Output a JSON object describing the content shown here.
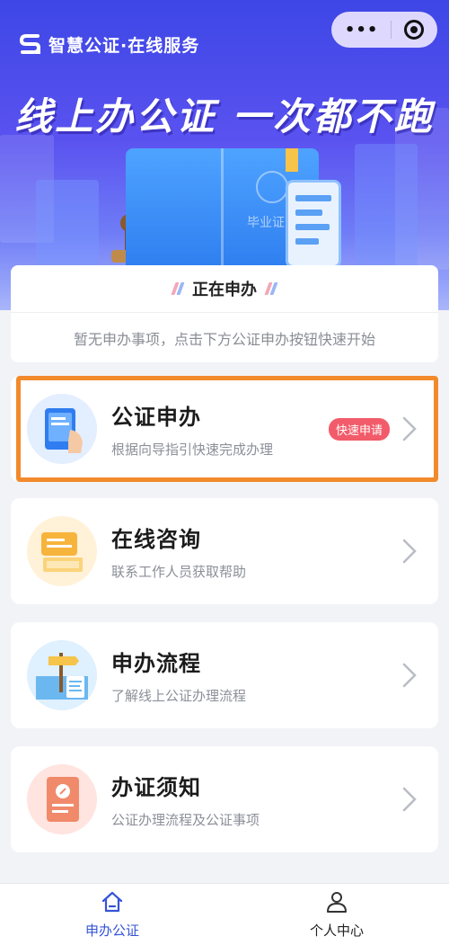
{
  "header": {
    "brand_title": "智慧公证·在线服务",
    "slogan": "线上办公证 一次都不跑",
    "banner_book_label": "毕业证"
  },
  "capsule": {
    "more_icon": "more-dots-icon",
    "close_icon": "target-circle-icon"
  },
  "status": {
    "title": "正在申办",
    "empty_text": "暂无申办事项，点击下方公证申办按钮快速开始"
  },
  "services": [
    {
      "title": "公证申办",
      "subtitle": "根据向导指引快速完成办理",
      "badge": "快速申请",
      "icon": "tablet-hand-icon"
    },
    {
      "title": "在线咨询",
      "subtitle": "联系工作人员获取帮助",
      "icon": "chat-laptop-icon"
    },
    {
      "title": "申办流程",
      "subtitle": "了解线上公证办理流程",
      "icon": "signpost-document-icon"
    },
    {
      "title": "办证须知",
      "subtitle": "公证办理流程及公证事项",
      "icon": "notice-document-icon"
    }
  ],
  "tabbar": {
    "items": [
      {
        "label": "申办公证",
        "icon": "home-icon",
        "active": true
      },
      {
        "label": "个人中心",
        "icon": "user-icon",
        "active": false
      }
    ]
  },
  "colors": {
    "banner_start": "#3d47e6",
    "accent_blue": "#3554d6",
    "highlight_orange": "#f28a2c",
    "badge_red": "#f25b6a"
  }
}
